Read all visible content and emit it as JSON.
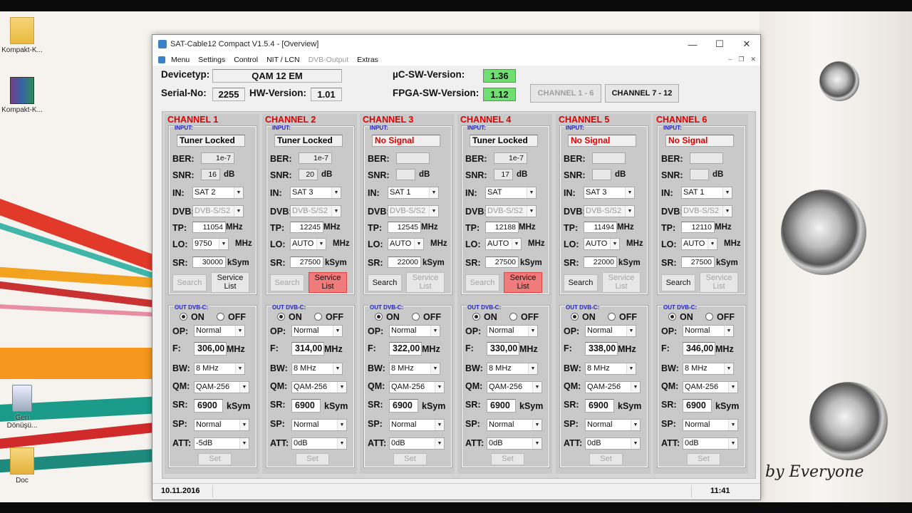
{
  "desktop": {
    "icons": [
      {
        "label": "Kompakt-K..."
      },
      {
        "label": "Kompakt-K..."
      },
      {
        "label": "Geri Dönüşü..."
      },
      {
        "label": "Doc"
      }
    ],
    "watermark": "by Everyone"
  },
  "window": {
    "title": "SAT-Cable12 Compact V1.5.4 - [Overview]",
    "controls": {
      "minimize": "—",
      "maximize": "☐",
      "close": "✕"
    },
    "menu": [
      "Menu",
      "Settings",
      "Control",
      "NIT / LCN",
      "DVB-Output",
      "Extras"
    ],
    "menu_disabled": [
      false,
      false,
      false,
      false,
      true,
      false
    ]
  },
  "header": {
    "devicetyp_label": "Devicetyp:",
    "devicetyp_value": "QAM 12 EM",
    "serial_label": "Serial-No:",
    "serial_value": "2255",
    "hw_label": "HW-Version:",
    "hw_value": "1.01",
    "uc_label": "µC-SW-Version:",
    "uc_value": "1.36",
    "fpga_label": "FPGA-SW-Version:",
    "fpga_value": "1.12",
    "btn_ch1_6": "CHANNEL 1 - 6",
    "btn_ch7_12": "CHANNEL 7 - 12",
    "status_green": "#6fe06f"
  },
  "labels": {
    "input": "INPUT:",
    "ber": "BER:",
    "snr": "SNR:",
    "db": "dB",
    "in": "IN:",
    "dvb": "DVB:",
    "tp": "TP:",
    "mhz": "MHz",
    "lo": "LO:",
    "sr": "SR:",
    "ksym": "kSym",
    "search": "Search",
    "service": "Service",
    "list": "List",
    "out": "OUT DVB-C:",
    "on": "ON",
    "off": "OFF",
    "op": "OP:",
    "f": "F:",
    "bw": "BW:",
    "qm": "QM:",
    "sp": "SP:",
    "att": "ATT:",
    "set": "Set"
  },
  "channels": [
    {
      "name": "CHANNEL 1",
      "status": "Tuner Locked",
      "status_red": false,
      "ber": "1e-7",
      "snr": "16",
      "in": "SAT 2",
      "dvb": "DVB-S/S2",
      "tp": "11054",
      "lo": "9750",
      "sr": "30000",
      "search_enabled": false,
      "service_red": false,
      "out_on": true,
      "op": "Normal",
      "f": "306,00",
      "bw": "8 MHz",
      "qm": "QAM-256",
      "osr": "6900",
      "sp": "Normal",
      "att": "-5dB"
    },
    {
      "name": "CHANNEL 2",
      "status": "Tuner Locked",
      "status_red": false,
      "ber": "1e-7",
      "snr": "20",
      "in": "SAT 3",
      "dvb": "DVB-S/S2",
      "tp": "12245",
      "lo": "AUTO",
      "sr": "27500",
      "search_enabled": false,
      "service_red": true,
      "out_on": true,
      "op": "Normal",
      "f": "314,00",
      "bw": "8 MHz",
      "qm": "QAM-256",
      "osr": "6900",
      "sp": "Normal",
      "att": "0dB"
    },
    {
      "name": "CHANNEL 3",
      "status": "No Signal",
      "status_red": true,
      "ber": "",
      "snr": "",
      "in": "SAT 1",
      "dvb": "DVB-S/S2",
      "tp": "12545",
      "lo": "AUTO",
      "sr": "22000",
      "search_enabled": true,
      "service_red": false,
      "out_on": true,
      "op": "Normal",
      "f": "322,00",
      "bw": "8 MHz",
      "qm": "QAM-256",
      "osr": "6900",
      "sp": "Normal",
      "att": "0dB"
    },
    {
      "name": "CHANNEL 4",
      "status": "Tuner Locked",
      "status_red": false,
      "ber": "1e-7",
      "snr": "17",
      "in": "SAT",
      "dvb": "DVB-S/S2",
      "tp": "12188",
      "lo": "AUTO",
      "sr": "27500",
      "search_enabled": false,
      "service_red": true,
      "out_on": true,
      "op": "Normal",
      "f": "330,00",
      "bw": "8 MHz",
      "qm": "QAM-256",
      "osr": "6900",
      "sp": "Normal",
      "att": "0dB"
    },
    {
      "name": "CHANNEL 5",
      "status": "No Signal",
      "status_red": true,
      "ber": "",
      "snr": "",
      "in": "SAT 3",
      "dvb": "DVB-S/S2",
      "tp": "11494",
      "lo": "AUTO",
      "sr": "22000",
      "search_enabled": true,
      "service_red": false,
      "out_on": true,
      "op": "Normal",
      "f": "338,00",
      "bw": "8 MHz",
      "qm": "QAM-256",
      "osr": "6900",
      "sp": "Normal",
      "att": "0dB"
    },
    {
      "name": "CHANNEL 6",
      "status": "No Signal",
      "status_red": true,
      "ber": "",
      "snr": "",
      "in": "SAT 1",
      "dvb": "DVB-S/S2",
      "tp": "12110",
      "lo": "AUTO",
      "sr": "27500",
      "search_enabled": true,
      "service_red": false,
      "out_on": true,
      "op": "Normal",
      "f": "346,00",
      "bw": "8 MHz",
      "qm": "QAM-256",
      "osr": "6900",
      "sp": "Normal",
      "att": "0dB"
    }
  ],
  "statusbar": {
    "date": "10.11.2016",
    "time": "11:41"
  }
}
